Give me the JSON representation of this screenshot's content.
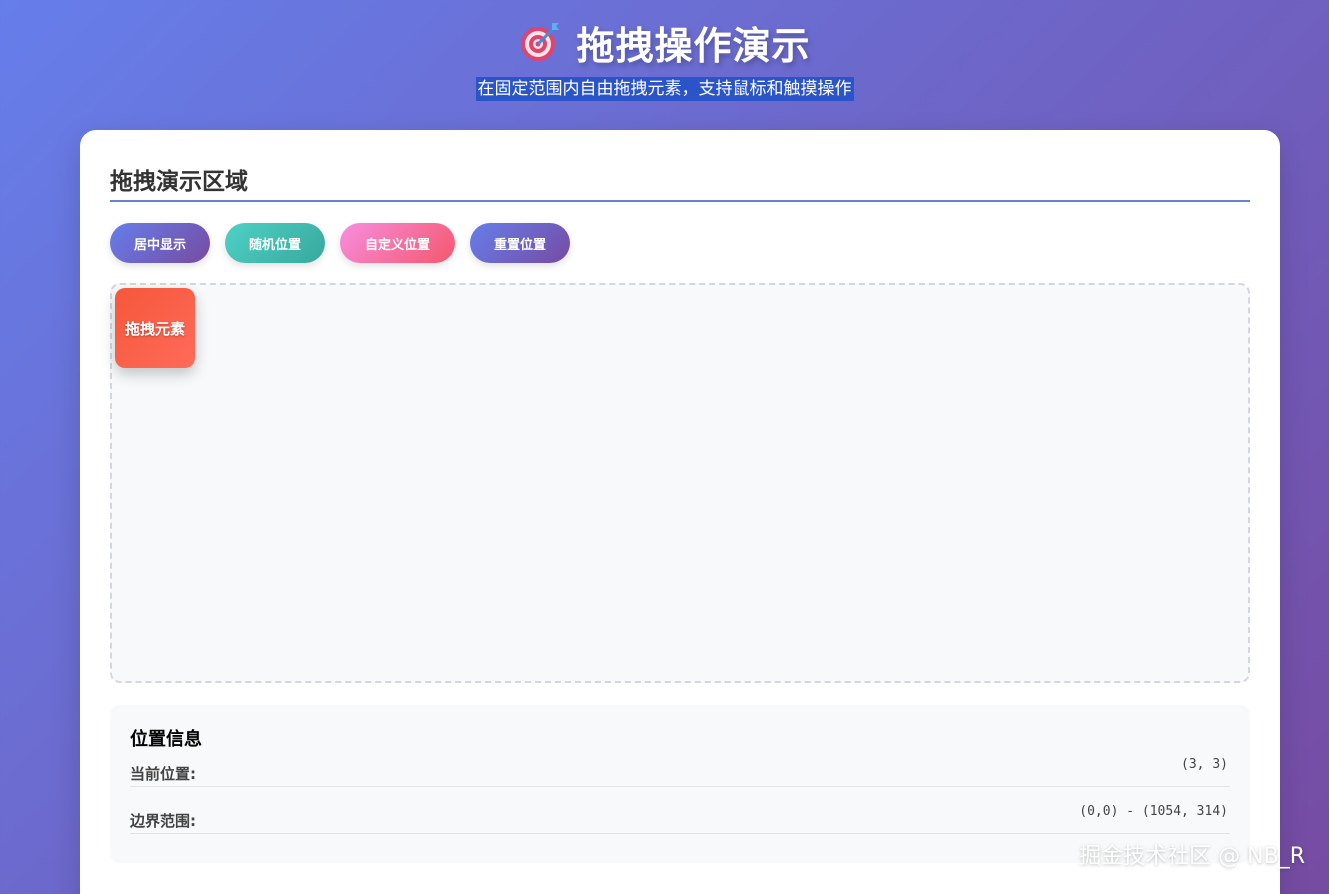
{
  "header": {
    "title": "拖拽操作演示",
    "subtitle": "在固定范围内自由拖拽元素，支持鼠标和触摸操作",
    "icon": "target-icon"
  },
  "card": {
    "title": "拖拽演示区域",
    "buttons": {
      "center": "居中显示",
      "random": "随机位置",
      "custom": "自定义位置",
      "reset": "重置位置"
    },
    "drag_element_label": "拖拽元素"
  },
  "info": {
    "title": "位置信息",
    "current_label": "当前位置:",
    "current_value": "(3, 3)",
    "bounds_label": "边界范围:",
    "bounds_value": "(0,0) - (1054, 314)"
  },
  "watermark": "掘金技术社区 @ NB_R",
  "colors": {
    "background_start": "#667eea",
    "background_end": "#764ba2",
    "drag_element": "#f5573a"
  }
}
